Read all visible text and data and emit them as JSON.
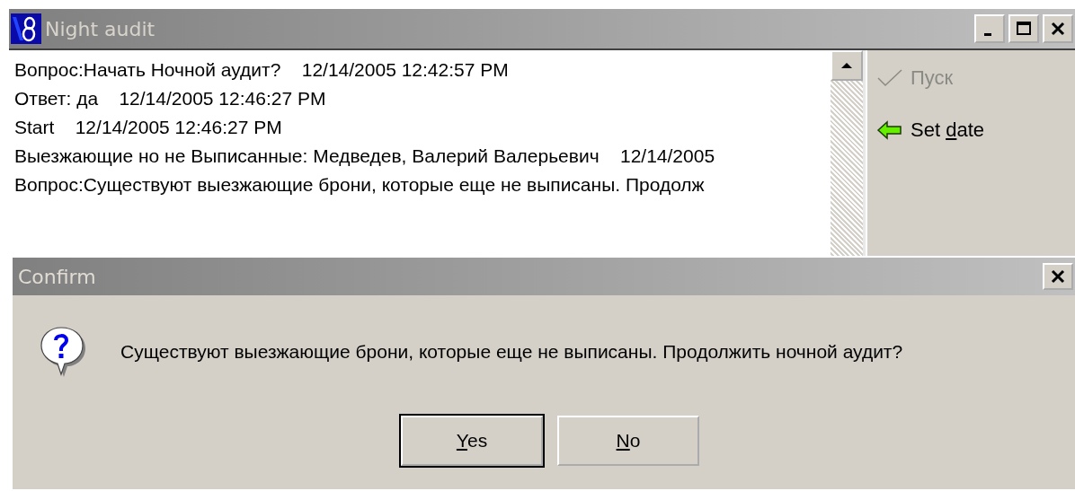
{
  "window": {
    "title": "Night audit"
  },
  "log": [
    "Вопрос:Начать Ночной аудит?    12/14/2005 12:42:57 PM",
    "Ответ: да    12/14/2005 12:46:27 PM",
    "Start    12/14/2005 12:46:27 PM",
    "Выезжающие но не Выписанные: Медведев, Валерий Валерьевич    12/14/2005",
    "Вопрос:Существуют выезжающие брони, которые еще не выписаны. Продолж"
  ],
  "actions": [
    {
      "kind": "check",
      "before": "Пуск",
      "disabled": true
    },
    {
      "kind": "arrow",
      "before": "Set ",
      "mnemonic": "d",
      "after": "ate",
      "disabled": false
    }
  ],
  "dialog": {
    "title": "Confirm",
    "message": "Существуют выезжающие брони, которые еще не выписаны. Продолжить ночной аудит?",
    "buttons": [
      {
        "mnemonic": "Y",
        "after": "es"
      },
      {
        "mnemonic": "N",
        "after": "o"
      }
    ]
  }
}
